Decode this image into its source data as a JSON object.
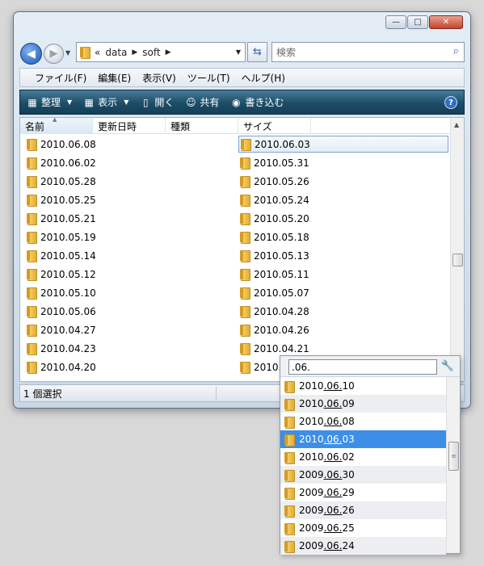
{
  "window": {
    "controls": {
      "minimize": "—",
      "maximize": "□",
      "close": "✕"
    }
  },
  "address": {
    "chevron": "«",
    "crumbs": [
      "data",
      "soft"
    ],
    "search_placeholder": "検索"
  },
  "menu": [
    "ファイル(F)",
    "編集(E)",
    "表示(V)",
    "ツール(T)",
    "ヘルプ(H)"
  ],
  "toolbar": {
    "organize": "整理",
    "view": "表示",
    "open": "開く",
    "share": "共有",
    "burn": "書き込む"
  },
  "columns": [
    "名前",
    "更新日時",
    "種類",
    "サイズ"
  ],
  "files_left": [
    "2010.06.08",
    "2010.06.02",
    "2010.05.28",
    "2010.05.25",
    "2010.05.21",
    "2010.05.19",
    "2010.05.14",
    "2010.05.12",
    "2010.05.10",
    "2010.05.06",
    "2010.04.27",
    "2010.04.23",
    "2010.04.20"
  ],
  "files_right": [
    "2010.06.03",
    "2010.05.31",
    "2010.05.26",
    "2010.05.24",
    "2010.05.20",
    "2010.05.18",
    "2010.05.13",
    "2010.05.11",
    "2010.05.07",
    "2010.04.28",
    "2010.04.26",
    "2010.04.21",
    "2010..."
  ],
  "selected_file": "2010.06.03",
  "status": {
    "selection": "1 個選択"
  },
  "popup": {
    "query": ".06.",
    "items": [
      {
        "pre": "2010",
        "hl": ".06.",
        "post": "10"
      },
      {
        "pre": "2010",
        "hl": ".06.",
        "post": "09"
      },
      {
        "pre": "2010",
        "hl": ".06.",
        "post": "08"
      },
      {
        "pre": "2010",
        "hl": ".06.",
        "post": "03",
        "selected": true
      },
      {
        "pre": "2010",
        "hl": ".06.",
        "post": "02"
      },
      {
        "pre": "2009",
        "hl": ".06.",
        "post": "30"
      },
      {
        "pre": "2009",
        "hl": ".06.",
        "post": "29"
      },
      {
        "pre": "2009",
        "hl": ".06.",
        "post": "26"
      },
      {
        "pre": "2009",
        "hl": ".06.",
        "post": "25"
      },
      {
        "pre": "2009",
        "hl": ".06.",
        "post": "24"
      }
    ]
  },
  "colors": {
    "accent": "#3d8ee6",
    "toolbar": "#1d4d67",
    "folder": "#e3ac2c"
  }
}
